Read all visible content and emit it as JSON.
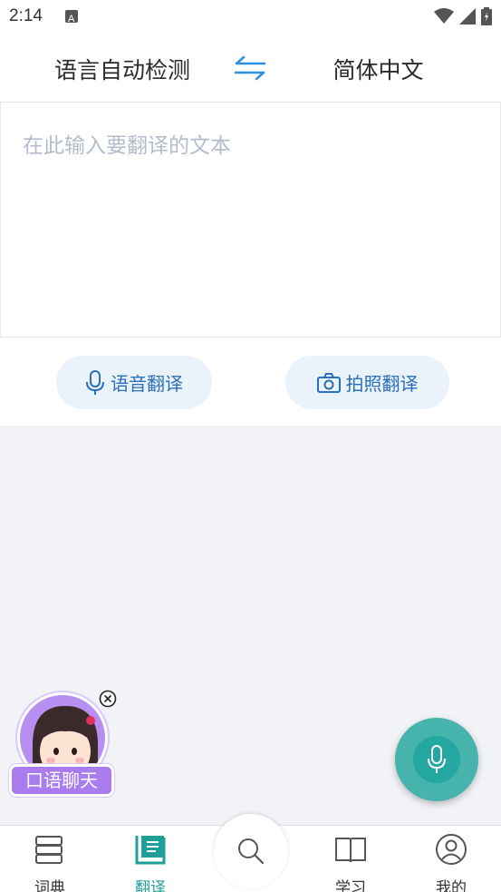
{
  "status_bar": {
    "time": "2:14",
    "icons": [
      "notification-a-icon",
      "wifi-icon",
      "signal-icon",
      "battery-icon"
    ]
  },
  "language_bar": {
    "source": "语言自动检测",
    "target": "简体中文",
    "swap_icon": "swap-arrows-icon"
  },
  "input": {
    "placeholder": "在此输入要翻译的文本",
    "value": ""
  },
  "actions": {
    "voice_label": "语音翻译",
    "photo_label": "拍照翻译"
  },
  "mascot": {
    "label": "口语聊天"
  },
  "bottom_nav": {
    "items": [
      {
        "label": "词典",
        "icon": "dictionary-icon",
        "active": false
      },
      {
        "label": "翻译",
        "icon": "translate-icon",
        "active": true
      },
      {
        "label": "学习",
        "icon": "book-icon",
        "active": false
      },
      {
        "label": "我的",
        "icon": "profile-icon",
        "active": false
      }
    ]
  },
  "colors": {
    "accent": "#1f9f98",
    "blue": "#2a6fb8",
    "mascot_purple": "#a97cf0",
    "fab": "#46b3ad"
  }
}
